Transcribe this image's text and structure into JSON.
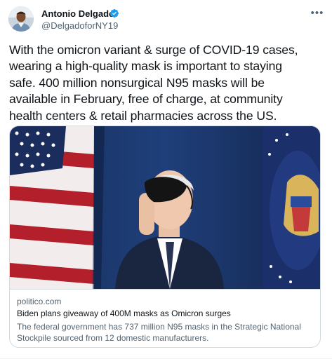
{
  "author": {
    "name": "Antonio Delgado",
    "handle": "@DelgadoforNY19",
    "verified": true,
    "avatar_icon": "profile-photo"
  },
  "more_icon": "more-horizontal-icon",
  "more_glyph": "•••",
  "tweet_text": "With the omicron variant & surge of COVID-19 cases,\nwearing a high-quality mask is important to staying\nsafe. 400 million nonsurgical N95 masks will be\navailable in February, free of charge, at community\nhealth centers & retail pharmacies across the US.",
  "link_card": {
    "domain": "politico.com",
    "title": "Biden plans giveaway of 400M masks as Omicron surges",
    "description": "The federal government has 737 million N95 masks in the Strategic National\nStockpile sourced from 12 domestic manufacturers."
  },
  "colors": {
    "text": "#0f1419",
    "secondary": "#536471",
    "border": "#cfd9de",
    "verified": "#1d9bf0"
  }
}
